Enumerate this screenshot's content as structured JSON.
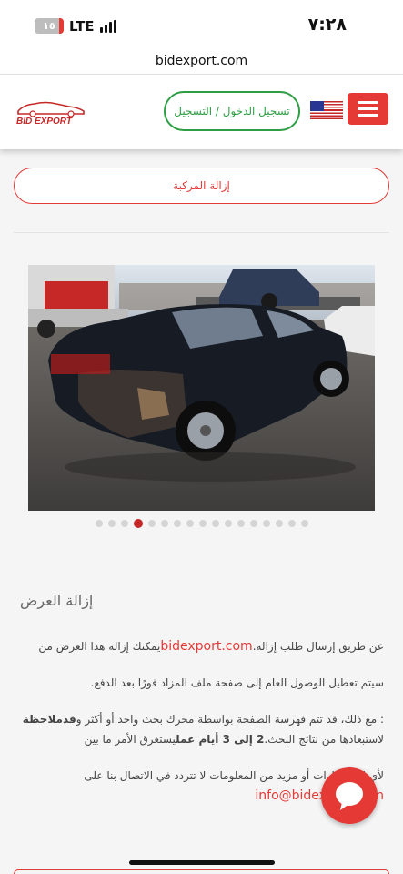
{
  "status_bar": {
    "time": "٧:٢٨",
    "network": "LTE",
    "battery_label": "١٥",
    "battery_level": 0.15,
    "battery_color": "#e53935"
  },
  "browser": {
    "url": "bidexport.com"
  },
  "header": {
    "logo_text": "BID EXPORT",
    "login_label": "تسجيل الدخول / التسجيل",
    "flag_icon": "us-flag-icon",
    "menu_icon": "hamburger-icon",
    "accent_color": "#e53935",
    "login_color": "#2e9e44"
  },
  "vehicle_button": {
    "label": "إزالة المركبة"
  },
  "gallery": {
    "image": "damaged-black-sedan-photo",
    "dot_count": 17,
    "active_index": 3
  },
  "content": {
    "heading": "إزالة العرض",
    "para1_pre": "عن طريق إرسال طلب إزالة.",
    "para1_link": "bidexport.com",
    "para1_post": "يمكنك إزالة هذا العرض من",
    "para2": "سيتم تعطيل الوصول العام إلى صفحة ملف المزاد فورًا بعد الدفع.",
    "para3_a": ": مع ذلك، قد تتم فهرسة الصفحة بواسطة محرك بحث واحد أو أكثر و",
    "para3_b": "قدملاحظة",
    "para3_c": "لاستبعادها من نتائج البحث.",
    "para3_d": "2 إلى 3 أيام عمل",
    "para3_e": "يستغرق الأمر ما بين",
    "para4": "لأي استفسارات أو مزيد من المعلومات لا تتردد في الاتصال بنا على",
    "email": "info@bidexport.com"
  },
  "chat": {
    "icon": "chat-bubble-icon"
  }
}
